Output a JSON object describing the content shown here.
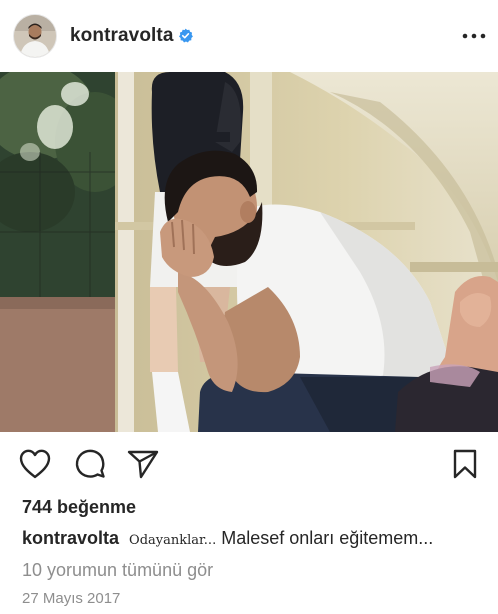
{
  "header": {
    "username": "kontravolta",
    "verified": true,
    "avatar_icon": "profile-avatar",
    "more_icon": "more-horizontal-icon"
  },
  "photo": {
    "content": "post-photo"
  },
  "actions": {
    "like_icon": "heart-icon",
    "comment_icon": "comment-icon",
    "share_icon": "share-icon",
    "save_icon": "bookmark-icon"
  },
  "likes": "744 beğenme",
  "caption": {
    "username": "kontravolta",
    "lead": "Odayanklar...",
    "text": " Malesef onları eğitemem..."
  },
  "view_comments": "10 yorumun tümünü gör",
  "date": "27 Mayıs 2017",
  "colors": {
    "text": "#262626",
    "secondary": "#8e8e8e",
    "verified": "#3897f0",
    "background": "#ffffff"
  }
}
